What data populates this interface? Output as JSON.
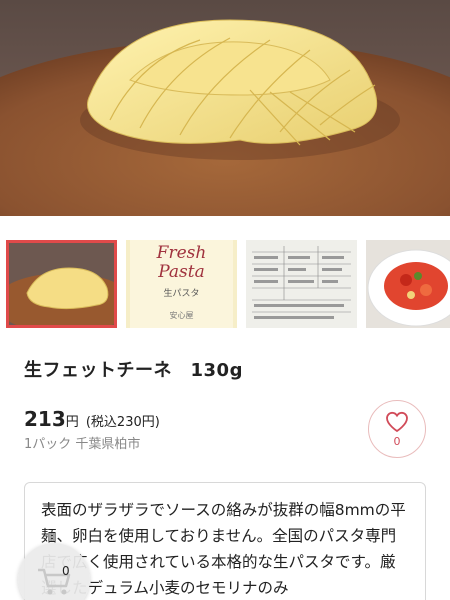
{
  "product": {
    "title": "生フェットチーネ　130g",
    "price": "213",
    "price_unit": "円",
    "price_tax": "(税込230円)",
    "origin": "1パック 千葉県柏市"
  },
  "favorite": {
    "count": "0",
    "icon": "heart-icon"
  },
  "thumbnail_package": {
    "brand_line1": "Fresh",
    "brand_line2": "Pasta",
    "subtitle": "生パスタ",
    "maker": "安心屋"
  },
  "description": {
    "text": "表面のザラザラでソースの絡みが抜群の幅8mmの平麺、卵白を使用しておりません。全国のパスタ専門店で広く使用されている本格的な生パスタです。厳選したデュラム小麦のセモリナのみ"
  },
  "cart": {
    "count": "0",
    "icon": "cart-icon"
  },
  "colors": {
    "accent": "#e04a4a",
    "heart": "#d14b59"
  }
}
